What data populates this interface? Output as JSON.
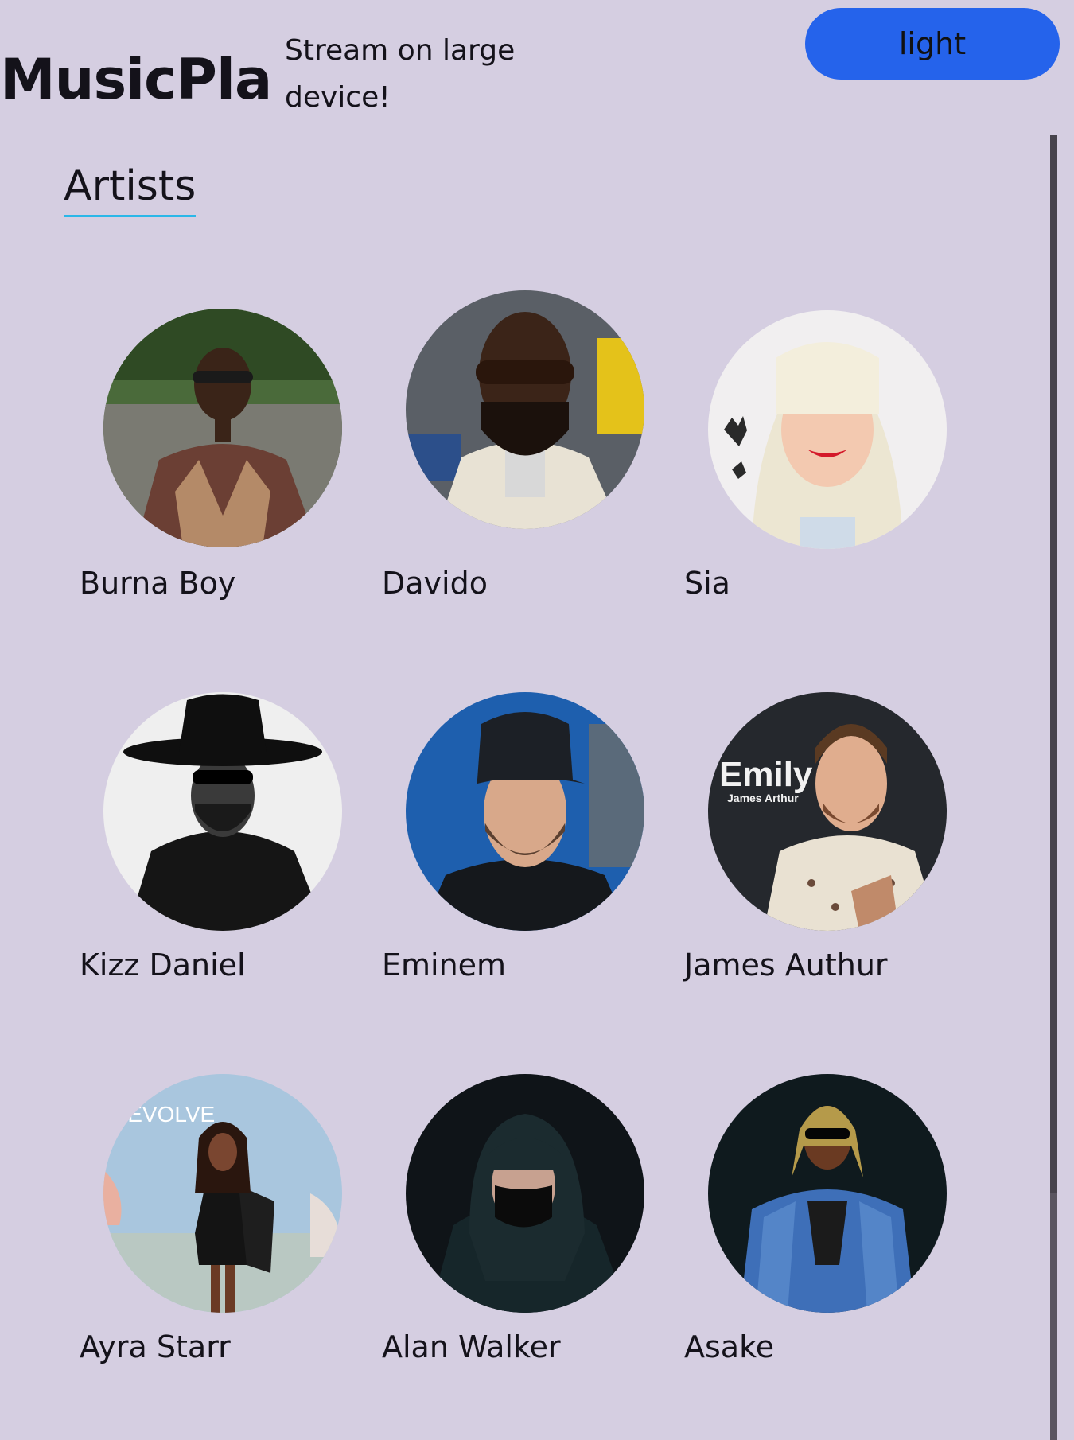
{
  "header": {
    "brand": "MusicPlanet",
    "tagline": "Stream on large device!",
    "theme_toggle_label": "light"
  },
  "section": {
    "title": "Artists"
  },
  "artists": [
    {
      "name": "Burna Boy"
    },
    {
      "name": "Davido"
    },
    {
      "name": "Sia"
    },
    {
      "name": "Kizz Daniel"
    },
    {
      "name": "Eminem"
    },
    {
      "name": "James Authur"
    },
    {
      "name": "Ayra Starr",
      "photo_text": "REVOLVE"
    },
    {
      "name": "Alan Walker"
    },
    {
      "name": "Asake"
    }
  ],
  "album_art_text": {
    "title": "Emily",
    "artist": "James Arthur"
  },
  "colors": {
    "background": "#d5cee1",
    "accent_button": "#2563eb",
    "title_underline": "#2bb7e8",
    "scrollbar": "#5a5560"
  }
}
